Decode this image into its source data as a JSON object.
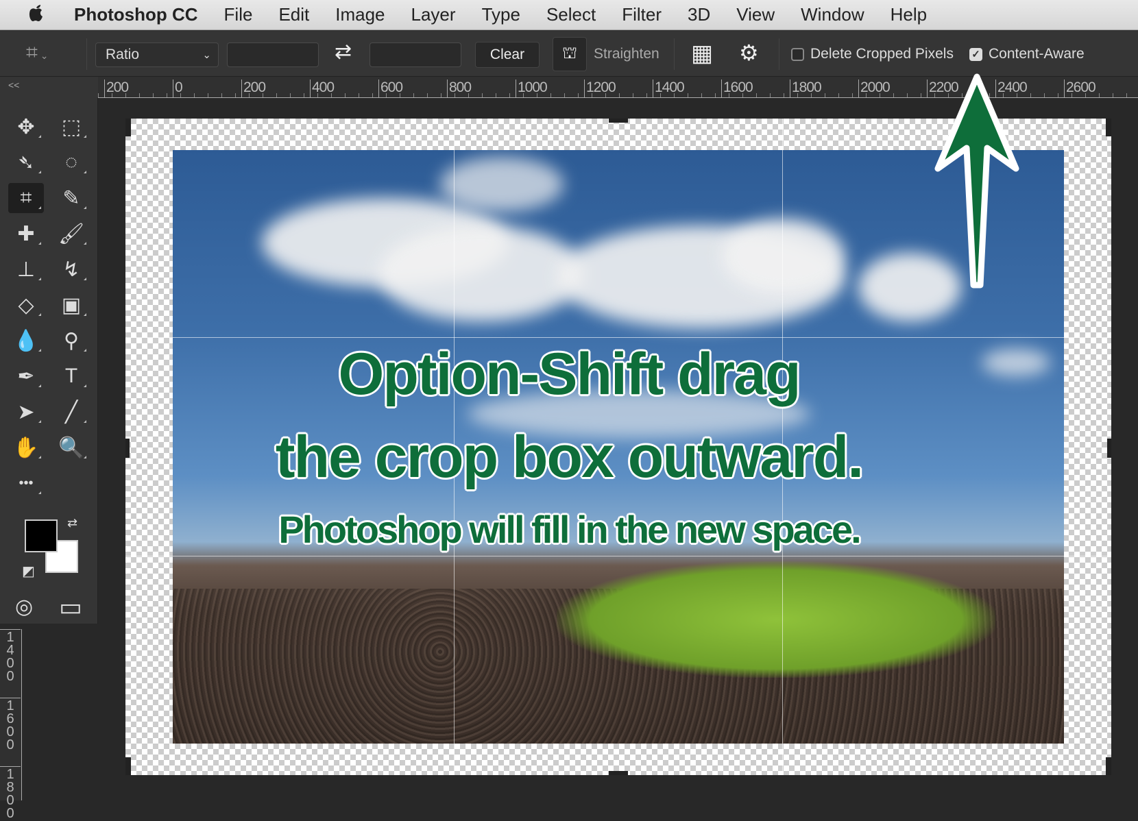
{
  "menubar": {
    "app": "Photoshop CC",
    "items": [
      "File",
      "Edit",
      "Image",
      "Layer",
      "Type",
      "Select",
      "Filter",
      "3D",
      "View",
      "Window",
      "Help"
    ]
  },
  "options": {
    "ratio": "Ratio",
    "width_value": "",
    "height_value": "",
    "clear": "Clear",
    "straighten": "Straighten",
    "delete_cropped": "Delete Cropped Pixels",
    "delete_cropped_checked": false,
    "content_aware": "Content-Aware",
    "content_aware_checked": true
  },
  "ruler": {
    "h_ticks": [
      "200",
      "0",
      "200",
      "400",
      "600",
      "800",
      "1000",
      "1200",
      "1400",
      "1600",
      "1800",
      "2000",
      "2200",
      "2400",
      "2600"
    ],
    "v_ticks": [
      "1400",
      "1600",
      "1800"
    ],
    "collapse": "<<"
  },
  "tools": [
    "move",
    "marquee",
    "lasso",
    "quick-select",
    "crop",
    "eyedropper",
    "healing",
    "brush",
    "stamp",
    "history-brush",
    "eraser",
    "gradient",
    "blur",
    "dodge",
    "pen",
    "type",
    "path-select",
    "line",
    "hand",
    "zoom",
    "more"
  ],
  "colors": {
    "foreground": "#000000",
    "background": "#ffffff",
    "annotation": "#0e6e3a"
  },
  "callout": {
    "line1": "Option-Shift drag",
    "line2": "the crop box outward.",
    "line3": "Photoshop will fill in the new space."
  }
}
